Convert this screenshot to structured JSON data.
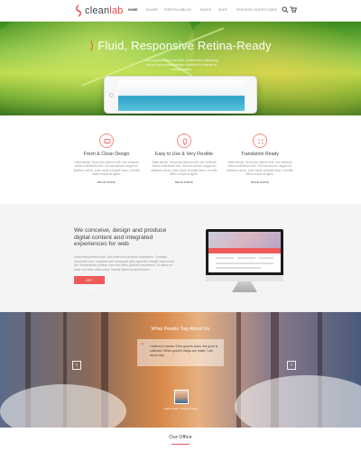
{
  "brand": {
    "name_main": "clean",
    "name_accent": "lab",
    "accent_color": "#ef5b5b"
  },
  "nav": {
    "items": [
      "Home",
      "Slider",
      "Portfolio",
      "Blog",
      "Pages",
      "Shop",
      "Features",
      "Shortcodes"
    ],
    "active_index": 0
  },
  "header_icons": [
    "search-icon",
    "cart-icon"
  ],
  "hero": {
    "title": "Fluid, Responsive Retina-Ready",
    "subtitle": "Lorem ipsum dolor sit amet, consectetur adipiscing elit sed do eiusmod tempor incididunt ut labore et dolore magna"
  },
  "features": [
    {
      "icon": "desktop-icon",
      "title": "Fresh & Clean Design",
      "text": "Nulla facilisi. Sed porta dictum velit, nec vehicula lectus sollicitudin sed. Sed accumsan, augue ac dapibus rutrum, justo turpis volutpat lacus, a mollis libero neque at ligula.",
      "link": "Read More"
    },
    {
      "icon": "location-pin-icon",
      "title": "Easy to Use & Very Flexible",
      "text": "Nulla facilisi. Sed porta dictum velit, nec vehicula lectus sollicitudin sed. Sed accumsan, augue ac dapibus rutrum, justo turpis volutpat lacus, a mollis libero neque at ligula.",
      "link": "Read More"
    },
    {
      "icon": "translate-icon",
      "title": "Translation Ready",
      "text": "Nulla facilisi. Sed porta dictum velit, nec vehicula lectus sollicitudin sed. Sed accumsan, augue ac dapibus rutrum, justo turpis volutpat lacus, a mollis libero neque at ligula.",
      "link": "Read More"
    }
  ],
  "intro": {
    "title": "We conceive, design and produce digital content and integrated experiences for web",
    "text": "Maecenas pharetra sed. Sed bibendum pulvinar consectetur. Curabitur commodo nunc, vulputate sed consequat quis imperdiet. Integer vitae luctus dui. Suspendisse pretium nunc sed libero gravida consectetur. Ut varius sit amet orci vitae ullamcorper. Mauris blandit pharetra lorem.",
    "button": "Get Started"
  },
  "testimonial": {
    "title": "What People Say About Us",
    "quote": "I believe in karma. If the good is sown, the good is collected. When good is things are made. I will return that.",
    "author": "Jordan Smith, Company Name",
    "prev": "‹",
    "next": "›"
  },
  "office": {
    "title": "Our Office"
  }
}
